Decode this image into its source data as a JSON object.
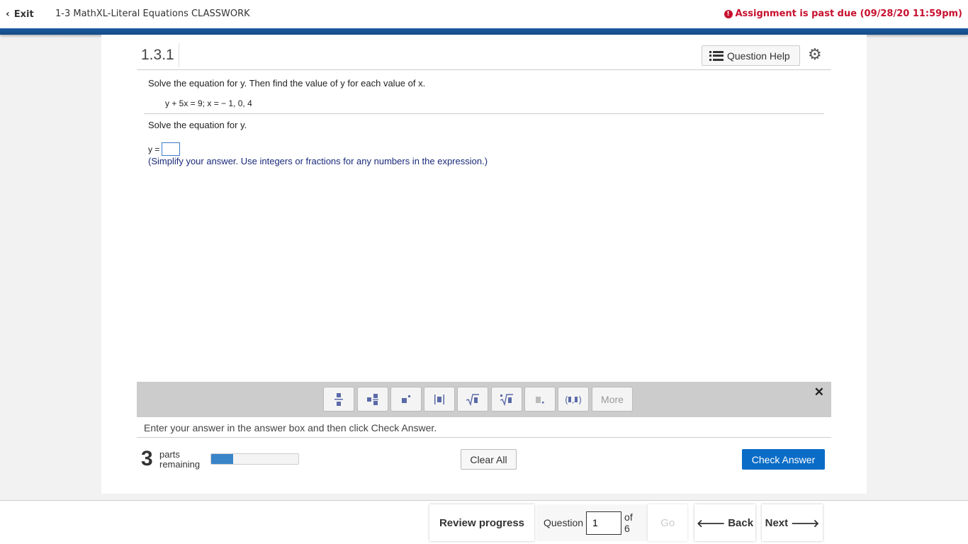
{
  "header": {
    "exit_label": "Exit",
    "assignment_title": "1-3 MathXL-Literal Equations CLASSWORK",
    "past_due": "Assignment is past due (09/28/20 11:59pm)"
  },
  "question": {
    "number": "1.3.1",
    "help_label": "Question Help",
    "instruction": "Solve the equation for y. Then find the value of y for each value of x.",
    "equation": "y + 5x = 9; x = − 1, 0, 4",
    "part_prompt": "Solve the equation for y.",
    "answer_prefix": "y =",
    "answer_value": "",
    "hint": "(Simplify your answer. Use integers or fractions for any numbers in the expression.)"
  },
  "palette": {
    "buttons": [
      {
        "name": "fraction-button",
        "symbol": "▪̲"
      },
      {
        "name": "mixed-number-button",
        "symbol": "▪▪"
      },
      {
        "name": "exponent-button",
        "symbol": "▪'"
      },
      {
        "name": "absolute-value-button",
        "symbol": "|▪|"
      },
      {
        "name": "square-root-button",
        "symbol": "√▪"
      },
      {
        "name": "nth-root-button",
        "symbol": "ⁿ√▪"
      },
      {
        "name": "decimal-button",
        "symbol": "▪."
      },
      {
        "name": "ordered-pair-button",
        "symbol": "(▪,▪)"
      }
    ],
    "more_label": "More",
    "close_symbol": "✕"
  },
  "footer": {
    "enter_note": "Enter your answer in the answer box and then click Check Answer.",
    "parts_count": "3",
    "parts_label_1": "parts",
    "parts_label_2": "remaining",
    "progress_fraction": 0.25,
    "clear_all_label": "Clear All",
    "check_answer_label": "Check Answer"
  },
  "nav": {
    "review_label": "Review progress",
    "question_label": "Question",
    "question_value": "1",
    "of_label": "of 6",
    "go_label": "Go",
    "back_label": "Back",
    "next_label": "Next"
  },
  "colors": {
    "accent_blue": "#0a6cc7",
    "past_due_red": "#c8102e",
    "header_bar": "#1b5aa0"
  }
}
